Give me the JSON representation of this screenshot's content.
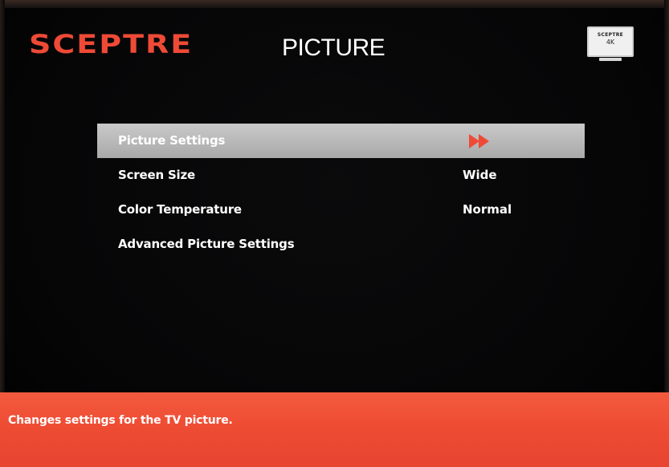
{
  "header": {
    "brand": "SCEPTRE",
    "title": "PICTURE",
    "tv_icon": {
      "brand": "SCEPTRE",
      "resolution": "4K",
      "icon": "tv-4k-icon"
    }
  },
  "menu": {
    "items": [
      {
        "label": "Picture Settings",
        "value": "",
        "selected": true,
        "icon": "double-arrow-right-icon"
      },
      {
        "label": "Screen Size",
        "value": "Wide",
        "selected": false
      },
      {
        "label": "Color Temperature",
        "value": "Normal",
        "selected": false
      },
      {
        "label": "Advanced Picture Settings",
        "value": "",
        "selected": false
      }
    ]
  },
  "help": {
    "text": "Changes settings for the TV picture."
  },
  "colors": {
    "accent": "#ee4a36",
    "selection": "#bdbdbd",
    "background": "#050506",
    "text": "#ffffff"
  }
}
